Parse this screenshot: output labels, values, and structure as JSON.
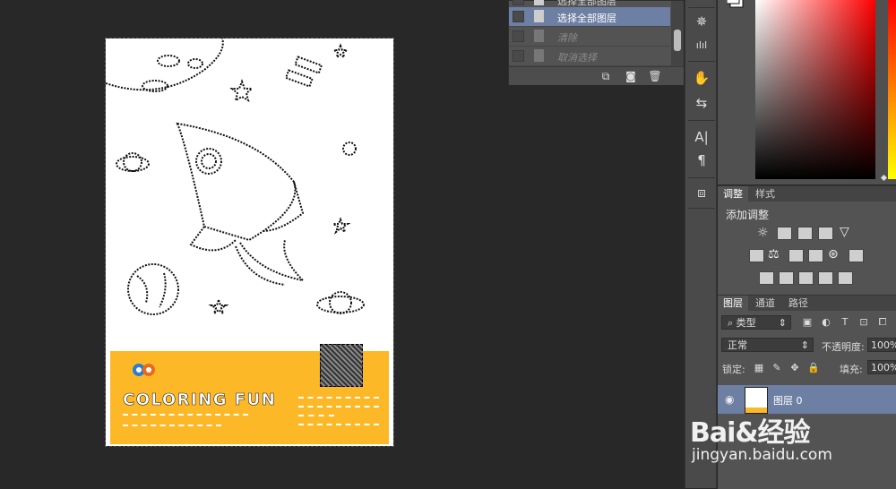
{
  "history": {
    "items": [
      {
        "label": "选择全部图层",
        "state": "partial"
      },
      {
        "label": "选择全部图层",
        "state": "selected"
      },
      {
        "label": "清除",
        "state": "dim"
      },
      {
        "label": "取消选择",
        "state": "dim"
      }
    ],
    "icons": [
      "new-document-icon",
      "camera-icon",
      "trash-icon"
    ]
  },
  "poster": {
    "title": "COLORING FUN",
    "band_color": "#fdb827"
  },
  "tools": [
    "crystal-icon",
    "text-size-icon",
    "hand-puppet-icon",
    "sliders-icon",
    "A|",
    "¶",
    "layer-comp-icon"
  ],
  "picker": {
    "hue_top": "#ff0000"
  },
  "adjust": {
    "tabs": [
      "调整",
      "样式"
    ],
    "title": "添加调整"
  },
  "layers": {
    "tabs": [
      "图层",
      "通道",
      "路径"
    ],
    "filter_kind": "类型",
    "blend_mode": "正常",
    "opacity_label": "不透明度:",
    "opacity_value": "100%",
    "lock_label": "锁定:",
    "fill_label": "填充:",
    "fill_value": "100%",
    "layer_name": "图层 0"
  },
  "watermark": {
    "main": "Bai&经验",
    "url": "jingyan.baidu.com"
  }
}
